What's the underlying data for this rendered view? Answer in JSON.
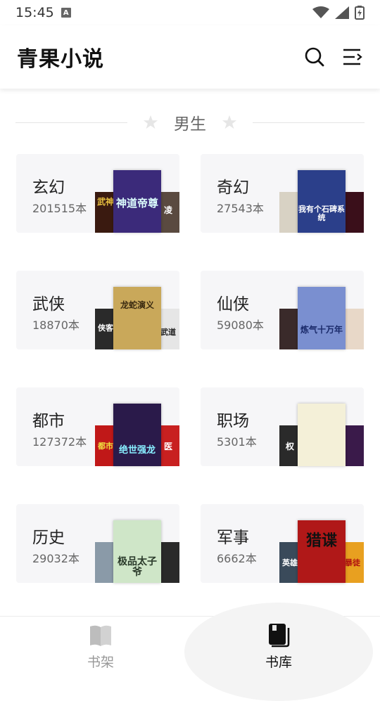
{
  "status": {
    "time": "15:45"
  },
  "header": {
    "title": "青果小说"
  },
  "section": {
    "title": "男生"
  },
  "categories": [
    {
      "name": "玄幻",
      "count": "201515本",
      "colors": {
        "left": "#3a1a10",
        "main": "#3b2a7a",
        "right": "#5a4a40"
      },
      "cover_text": "神道帝尊",
      "side_left_text": "武神",
      "side_right_text": "凌"
    },
    {
      "name": "奇幻",
      "count": "27543本",
      "colors": {
        "left": "#d8d2c4",
        "main": "#2b3f8a",
        "right": "#3a0f1a"
      },
      "cover_text": "我有个石碑系统",
      "side_left_text": "",
      "side_right_text": ""
    },
    {
      "name": "武侠",
      "count": "18870本",
      "colors": {
        "left": "#2a2a2a",
        "main": "#c9a85a",
        "right": "#e6e6e6"
      },
      "cover_text": "龙蛇演义",
      "side_left_text": "侠客",
      "side_right_text": "武道"
    },
    {
      "name": "仙侠",
      "count": "59080本",
      "colors": {
        "left": "#3a2a2a",
        "main": "#7a8fd0",
        "right": "#e8d8c8"
      },
      "cover_text": "炼气十万年",
      "side_left_text": "",
      "side_right_text": ""
    },
    {
      "name": "都市",
      "count": "127372本",
      "colors": {
        "left": "#c01818",
        "main": "#2a1a4a",
        "right": "#c82020"
      },
      "cover_text": "绝世强龙",
      "side_left_text": "都市",
      "side_right_text": "医"
    },
    {
      "name": "职场",
      "count": "5301本",
      "colors": {
        "left": "#2a2a2a",
        "main": "#f4f0d8",
        "right": "#3a1a4a"
      },
      "cover_text": "",
      "side_left_text": "权",
      "side_right_text": ""
    },
    {
      "name": "历史",
      "count": "29032本",
      "colors": {
        "left": "#8a9aa8",
        "main": "#cfe6c8",
        "right": "#2a2a2a"
      },
      "cover_text": "极品太子爷",
      "side_left_text": "",
      "side_right_text": ""
    },
    {
      "name": "军事",
      "count": "6662本",
      "colors": {
        "left": "#3a4a5a",
        "main": "#b01818",
        "right": "#e8a020"
      },
      "cover_text": "猎谍",
      "side_left_text": "英雄",
      "side_right_text": "暴徒"
    }
  ],
  "nav": {
    "bookshelf": "书架",
    "library": "书库"
  },
  "colors": {
    "accent": "#111111",
    "inactive": "#999999",
    "card_bg": "#f6f6f8"
  }
}
